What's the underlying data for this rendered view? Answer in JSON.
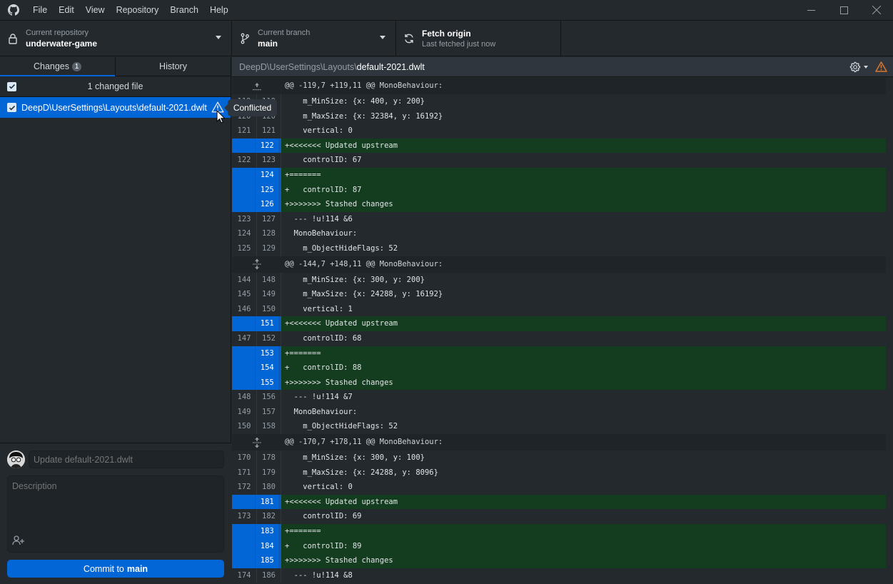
{
  "menu": {
    "items": [
      "File",
      "Edit",
      "View",
      "Repository",
      "Branch",
      "Help"
    ]
  },
  "toolbar": {
    "repository": {
      "label": "Current repository",
      "value": "underwater-game"
    },
    "branch": {
      "label": "Current branch",
      "value": "main"
    },
    "fetch": {
      "label": "Fetch origin",
      "status": "Last fetched just now"
    }
  },
  "sidebar": {
    "tabs": [
      {
        "label": "Changes",
        "badge": "1",
        "selected": true
      },
      {
        "label": "History",
        "selected": false
      }
    ],
    "changes_summary": "1 changed file",
    "files": [
      {
        "path": "DeepD\\UserSettings\\Layouts\\default-2021.dwlt",
        "status": "Conflicted",
        "checked": true
      }
    ],
    "tooltip": "Conflicted"
  },
  "commit": {
    "summary_placeholder": "Update default-2021.dwlt",
    "description_placeholder": "Description",
    "button_prefix": "Commit to",
    "button_branch": "main"
  },
  "diff": {
    "path_dir": "DeepD\\UserSettings\\Layouts\\",
    "path_file": "default-2021.dwlt",
    "colors": {
      "added_bg": "#143c1e",
      "gutter_selected": "#0366d6",
      "warning": "#d9772e"
    },
    "lines": [
      {
        "type": "hunk",
        "old": "",
        "new": "",
        "text": "@@ -119,7 +119,11 @@ MonoBehaviour:",
        "expander": "up"
      },
      {
        "type": "context",
        "old": "119",
        "new": "119",
        "text": "    m_MinSize: {x: 400, y: 200}"
      },
      {
        "type": "context",
        "old": "120",
        "new": "120",
        "text": "    m_MaxSize: {x: 32384, y: 16192}"
      },
      {
        "type": "context",
        "old": "121",
        "new": "121",
        "text": "    vertical: 0"
      },
      {
        "type": "add",
        "old": "",
        "new": "122",
        "text": "+<<<<<<< Updated upstream"
      },
      {
        "type": "context",
        "old": "122",
        "new": "123",
        "text": "    controlID: 67"
      },
      {
        "type": "add",
        "old": "",
        "new": "124",
        "text": "+======="
      },
      {
        "type": "add",
        "old": "",
        "new": "125",
        "text": "+   controlID: 87"
      },
      {
        "type": "add",
        "old": "",
        "new": "126",
        "text": "+>>>>>>> Stashed changes"
      },
      {
        "type": "context",
        "old": "123",
        "new": "127",
        "text": "  --- !u!114 &6"
      },
      {
        "type": "context",
        "old": "124",
        "new": "128",
        "text": "  MonoBehaviour:"
      },
      {
        "type": "context",
        "old": "125",
        "new": "129",
        "text": "    m_ObjectHideFlags: 52"
      },
      {
        "type": "hunk",
        "old": "",
        "new": "",
        "text": "@@ -144,7 +148,11 @@ MonoBehaviour:",
        "expander": "both"
      },
      {
        "type": "context",
        "old": "144",
        "new": "148",
        "text": "    m_MinSize: {x: 300, y: 200}"
      },
      {
        "type": "context",
        "old": "145",
        "new": "149",
        "text": "    m_MaxSize: {x: 24288, y: 16192}"
      },
      {
        "type": "context",
        "old": "146",
        "new": "150",
        "text": "    vertical: 1"
      },
      {
        "type": "add",
        "old": "",
        "new": "151",
        "text": "+<<<<<<< Updated upstream"
      },
      {
        "type": "context",
        "old": "147",
        "new": "152",
        "text": "    controlID: 68"
      },
      {
        "type": "add",
        "old": "",
        "new": "153",
        "text": "+======="
      },
      {
        "type": "add",
        "old": "",
        "new": "154",
        "text": "+   controlID: 88"
      },
      {
        "type": "add",
        "old": "",
        "new": "155",
        "text": "+>>>>>>> Stashed changes"
      },
      {
        "type": "context",
        "old": "148",
        "new": "156",
        "text": "  --- !u!114 &7"
      },
      {
        "type": "context",
        "old": "149",
        "new": "157",
        "text": "  MonoBehaviour:"
      },
      {
        "type": "context",
        "old": "150",
        "new": "158",
        "text": "    m_ObjectHideFlags: 52"
      },
      {
        "type": "hunk",
        "old": "",
        "new": "",
        "text": "@@ -170,7 +178,11 @@ MonoBehaviour:",
        "expander": "both"
      },
      {
        "type": "context",
        "old": "170",
        "new": "178",
        "text": "    m_MinSize: {x: 300, y: 100}"
      },
      {
        "type": "context",
        "old": "171",
        "new": "179",
        "text": "    m_MaxSize: {x: 24288, y: 8096}"
      },
      {
        "type": "context",
        "old": "172",
        "new": "180",
        "text": "    vertical: 0"
      },
      {
        "type": "add",
        "old": "",
        "new": "181",
        "text": "+<<<<<<< Updated upstream"
      },
      {
        "type": "context",
        "old": "173",
        "new": "182",
        "text": "    controlID: 69"
      },
      {
        "type": "add",
        "old": "",
        "new": "183",
        "text": "+======="
      },
      {
        "type": "add",
        "old": "",
        "new": "184",
        "text": "+   controlID: 89"
      },
      {
        "type": "add",
        "old": "",
        "new": "185",
        "text": "+>>>>>>> Stashed changes"
      },
      {
        "type": "context",
        "old": "174",
        "new": "186",
        "text": "  --- !u!114 &8"
      }
    ]
  }
}
